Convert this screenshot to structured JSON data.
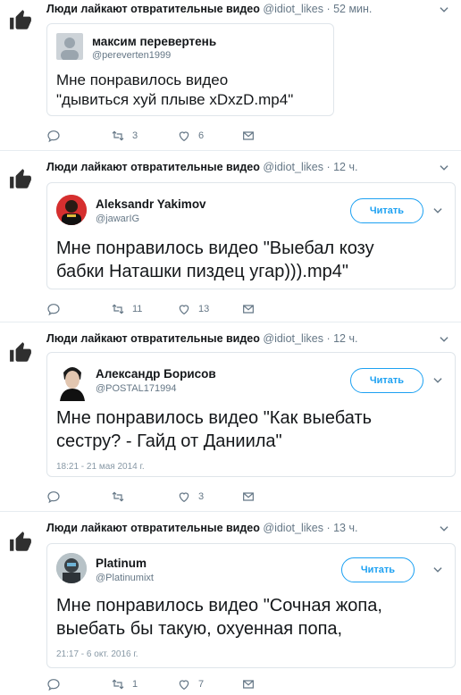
{
  "tweets": [
    {
      "account_name": "Люди лайкают отвратительные видео",
      "account_handle": "@idiot_likes",
      "time": "· 52 мин.",
      "quoted_name": "максим перевертень",
      "quoted_handle": "@pereverten1999",
      "quoted_text_line1": "Мне понравилось видео",
      "quoted_text_line2": "\"дывиться хуй плыве xDxzD.mp4\"",
      "retweets": "3",
      "likes": "6"
    },
    {
      "account_name": "Люди лайкают отвратительные видео",
      "account_handle": "@idiot_likes",
      "time": "· 12 ч.",
      "quoted_name": "Aleksandr Yakimov",
      "quoted_handle": "@jawarIG",
      "follow_label": "Читать",
      "quoted_text_line1": "Мне понравилось видео \"Выебал козу",
      "quoted_text_line2": "бабки Наташки пиздец угар))).mp4\"",
      "retweets": "11",
      "likes": "13"
    },
    {
      "account_name": "Люди лайкают отвратительные видео",
      "account_handle": "@idiot_likes",
      "time": "· 12 ч.",
      "quoted_name": "Александр Борисов",
      "quoted_handle": "@POSTAL171994",
      "follow_label": "Читать",
      "quoted_text_line1": "Мне понравилось видео \"Как выебать",
      "quoted_text_line2": "сестру? - Гайд от Даниила\"",
      "quoted_date": "18:21 - 21 мая 2014 г.",
      "likes": "3"
    },
    {
      "account_name": "Люди лайкают отвратительные видео",
      "account_handle": "@idiot_likes",
      "time": "· 13 ч.",
      "quoted_name": "Platinum",
      "quoted_handle": "@Platinumixt",
      "follow_label": "Читать",
      "quoted_text_line1": "Мне понравилось видео \"Сочная жопа,",
      "quoted_text_line2": "выебать бы такую, охуенная попа,",
      "quoted_date": "21:17 - 6 окт. 2016 г.",
      "retweets": "1",
      "likes": "7"
    }
  ],
  "colors": {
    "accent": "#1da1f2",
    "muted": "#657786",
    "border": "#e6ecf0",
    "like_icon": "#2f2f2f"
  }
}
